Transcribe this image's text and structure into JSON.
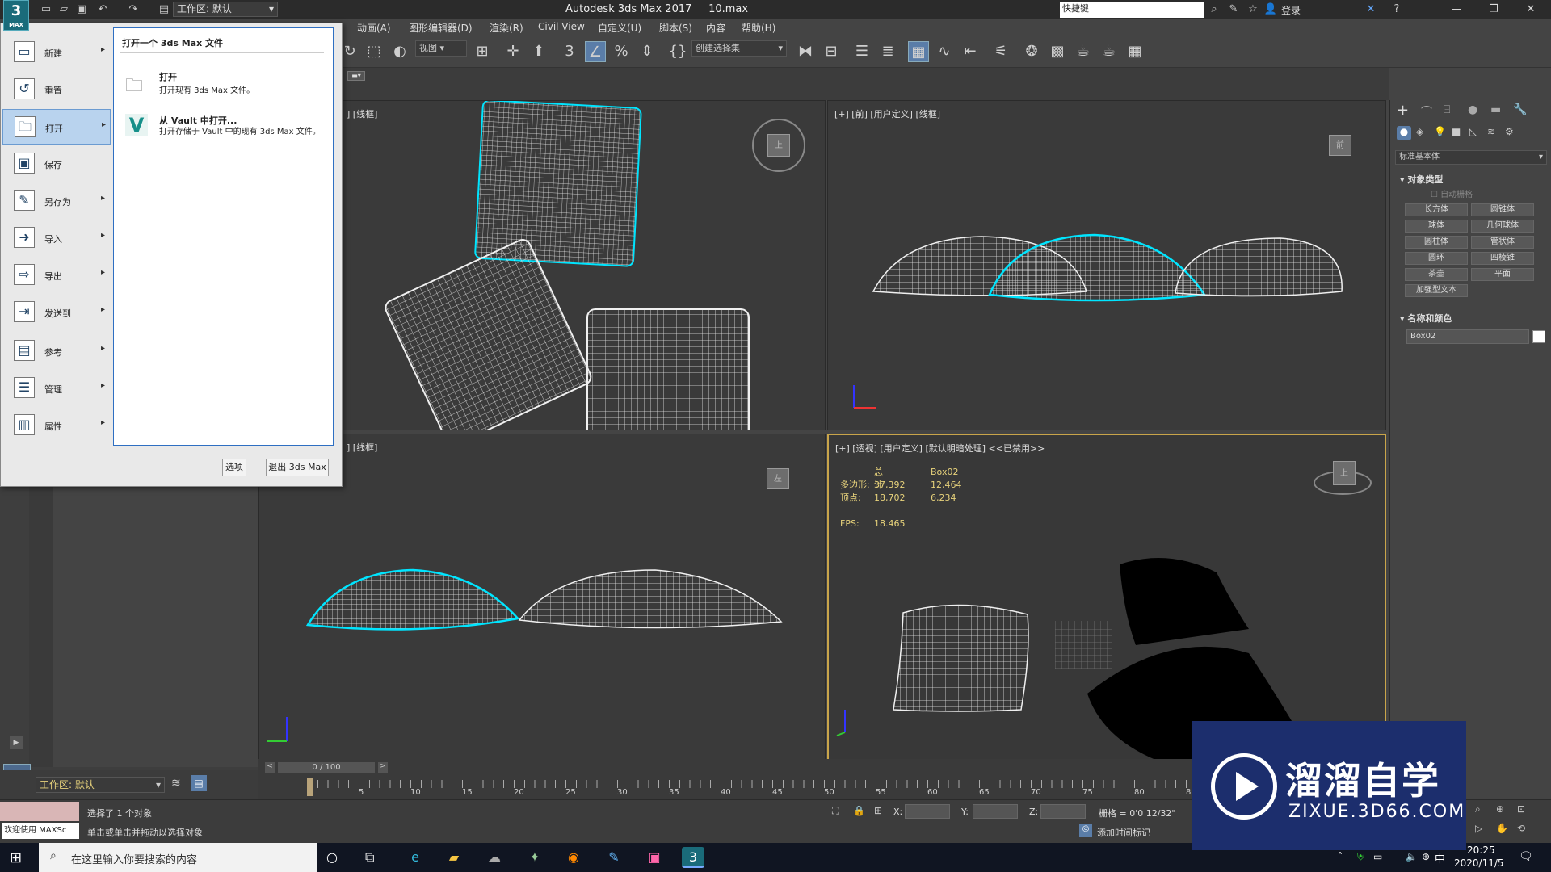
{
  "window": {
    "title": "Autodesk 3ds Max 2017",
    "filename": "10.max",
    "workspace": "工作区: 默认",
    "search_placeholder": "快捷键",
    "login": "登录"
  },
  "menubar": {
    "items": [
      "动画(A)",
      "图形编辑器(D)",
      "渲染(R)",
      "Civil View",
      "自定义(U)",
      "脚本(S)",
      "内容",
      "帮助(H)"
    ]
  },
  "toolbar": {
    "view_dropdown": "视图",
    "selection_set": "创建选择集"
  },
  "viewports": {
    "top_left_label": "] [线框]",
    "top_right_label": "[+] [前] [用户定义] [线框]",
    "bottom_left_label": "] [线框]",
    "bottom_right_label": "[+] [透视] [用户定义] [默认明暗处理] <<已禁用>>",
    "stats": {
      "header_total": "总计",
      "header_object": "Box02",
      "poly_label": "多边形:",
      "poly_total": "37,392",
      "poly_object": "12,464",
      "vert_label": "顶点:",
      "vert_total": "18,702",
      "vert_object": "6,234",
      "fps_label": "FPS:",
      "fps_value": "18.465"
    }
  },
  "command_panel": {
    "dropdown": "标准基本体",
    "object_type_title": "对象类型",
    "autogrid": "自动栅格",
    "buttons": [
      "长方体",
      "圆锥体",
      "球体",
      "几何球体",
      "圆柱体",
      "管状体",
      "圆环",
      "四棱锥",
      "茶壶",
      "平面",
      "加强型文本"
    ],
    "name_color_title": "名称和颜色",
    "object_name": "Box02"
  },
  "app_menu": {
    "items": [
      {
        "label": "新建",
        "icon": "new-file-icon",
        "arrow": true
      },
      {
        "label": "重置",
        "icon": "reset-icon",
        "arrow": false
      },
      {
        "label": "打开",
        "icon": "open-folder-icon",
        "arrow": true
      },
      {
        "label": "保存",
        "icon": "save-icon",
        "arrow": false
      },
      {
        "label": "另存为",
        "icon": "save-as-icon",
        "arrow": true
      },
      {
        "label": "导入",
        "icon": "import-icon",
        "arrow": true
      },
      {
        "label": "导出",
        "icon": "export-icon",
        "arrow": true
      },
      {
        "label": "发送到",
        "icon": "send-to-icon",
        "arrow": true
      },
      {
        "label": "参考",
        "icon": "reference-icon",
        "arrow": true
      },
      {
        "label": "管理",
        "icon": "manage-icon",
        "arrow": true
      },
      {
        "label": "属性",
        "icon": "properties-icon",
        "arrow": true
      }
    ],
    "submenu_title": "打开一个 3ds Max 文件",
    "open_title": "打开",
    "open_desc": "打开现有 3ds Max 文件。",
    "vault_title": "从 Vault 中打开...",
    "vault_desc": "打开存储于 Vault 中的现有 3ds Max 文件。",
    "options_button": "选项",
    "exit_button": "退出 3ds Max"
  },
  "timeline": {
    "frame_counter": "0 / 100",
    "ticks": [
      "5",
      "10",
      "15",
      "20",
      "25",
      "30",
      "35",
      "40",
      "45",
      "50",
      "55",
      "60",
      "65",
      "70",
      "75",
      "80",
      "85"
    ]
  },
  "left_panel": {
    "workspace": "工作区: 默认"
  },
  "status": {
    "welcome": "欢迎使用 MAXSc",
    "selected": "选择了 1 个对象",
    "hint": "单击或单击并拖动以选择对象",
    "x_label": "X:",
    "y_label": "Y:",
    "z_label": "Z:",
    "grid": "栅格 = 0'0 12/32\"",
    "add_time_tag": "添加时间标记"
  },
  "taskbar": {
    "search_placeholder": "在这里输入你要搜索的内容",
    "time": "20:25",
    "date": "2020/11/5",
    "ime": "中"
  },
  "watermark": {
    "brand": "溜溜自学",
    "url": "ZIXUE.3D66.COM"
  },
  "colors": {
    "accent_selected": "#00e5ff",
    "active_viewport_border": "#c9a54a",
    "stats_text": "#e7d27b"
  }
}
